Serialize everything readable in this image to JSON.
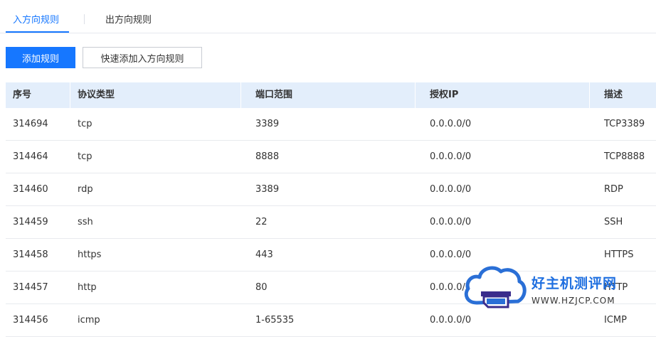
{
  "tabs": [
    {
      "label": "入方向规则",
      "active": true
    },
    {
      "label": "出方向规则",
      "active": false
    }
  ],
  "toolbar": {
    "add_label": "添加规则",
    "quick_add_label": "快速添加入方向规则"
  },
  "table": {
    "headers": [
      "序号",
      "协议类型",
      "端口范围",
      "授权IP",
      "描述"
    ],
    "rows": [
      [
        "314694",
        "tcp",
        "3389",
        "0.0.0.0/0",
        "TCP3389"
      ],
      [
        "314464",
        "tcp",
        "8888",
        "0.0.0.0/0",
        "TCP8888"
      ],
      [
        "314460",
        "rdp",
        "3389",
        "0.0.0.0/0",
        "RDP"
      ],
      [
        "314459",
        "ssh",
        "22",
        "0.0.0.0/0",
        "SSH"
      ],
      [
        "314458",
        "https",
        "443",
        "0.0.0.0/0",
        "HTTPS"
      ],
      [
        "314457",
        "http",
        "80",
        "0.0.0.0/0",
        "HTTP"
      ],
      [
        "314456",
        "icmp",
        "1-65535",
        "0.0.0.0/0",
        "ICMP"
      ]
    ]
  },
  "watermark": {
    "title": "好主机测评网",
    "url": "WWW.HZJCP.COM"
  },
  "colors": {
    "accent": "#1677ff",
    "header_bg": "#e3eefb",
    "watermark_blue": "#1f6fe0"
  }
}
